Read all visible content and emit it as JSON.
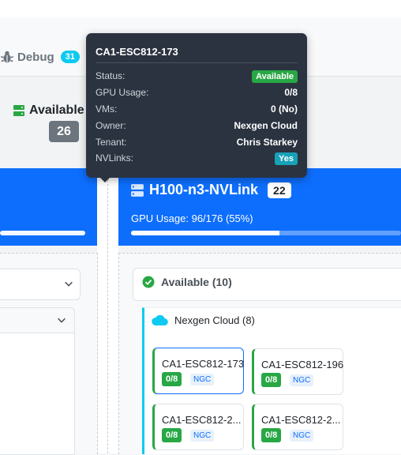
{
  "tabs": {
    "debug_label": "Debug",
    "debug_count": "31"
  },
  "stats": {
    "available_label": "Available I",
    "available_count": "26"
  },
  "gpu_group": {
    "title": "H100-n3-NVLink",
    "count": "22",
    "usage_text": "GPU Usage: 96/176 (55%)",
    "usage_fraction": 0.55
  },
  "available_section": {
    "label": "Available (10)"
  },
  "owner_section": {
    "label": "Nexgen Cloud (8)"
  },
  "nodes": [
    {
      "name": "CA1-ESC812-173",
      "usage": "0/8",
      "tag": "NGC"
    },
    {
      "name": "CA1-ESC812-196",
      "usage": "0/8",
      "tag": "NGC"
    },
    {
      "name": "CA1-ESC812-2...",
      "usage": "0/8",
      "tag": "NGC"
    },
    {
      "name": "CA1-ESC812-2...",
      "usage": "0/8",
      "tag": "NGC"
    }
  ],
  "tooltip": {
    "title": "CA1-ESC812-173",
    "rows": [
      {
        "key": "Status:",
        "value": "Available"
      },
      {
        "key": "GPU Usage:",
        "value": "0/8"
      },
      {
        "key": "VMs:",
        "value": "0 (No)"
      },
      {
        "key": "Owner:",
        "value": "Nexgen Cloud"
      },
      {
        "key": "Tenant:",
        "value": "Chris Starkey"
      },
      {
        "key": "NVLinks:",
        "value": "Yes"
      }
    ]
  },
  "colors": {
    "primary": "#0d6efd",
    "success": "#28a745",
    "info": "#0dcaf0",
    "teal": "#17a2b8",
    "tooltip_bg": "#2b3340"
  },
  "icons": {
    "debug": "bug-icon",
    "available_stat": "server-icon",
    "group": "server-icon",
    "available_section": "check-circle-icon",
    "owner": "cloud-icon",
    "collapse": "chevron-down-icon"
  }
}
